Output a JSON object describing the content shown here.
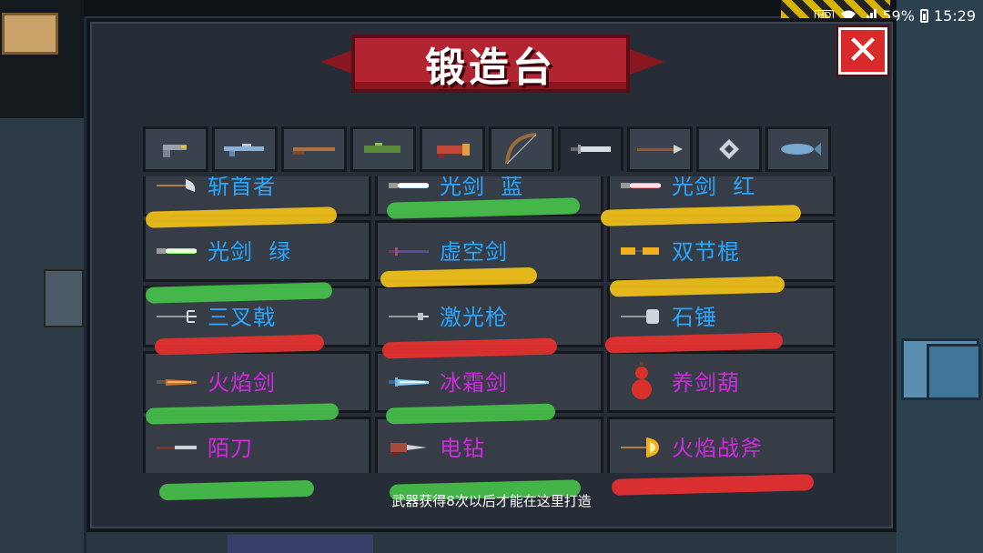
{
  "status_bar": {
    "hd_badge": "HD",
    "battery_percent": "59%",
    "time": "15:29"
  },
  "title": "锻造台",
  "close_icon": "close-icon",
  "tabs": [
    {
      "icon": "pistol-icon",
      "selected": false
    },
    {
      "icon": "rifle-icon",
      "selected": false
    },
    {
      "icon": "shotgun-icon",
      "selected": false
    },
    {
      "icon": "launcher-icon",
      "selected": false
    },
    {
      "icon": "heavy-gun-icon",
      "selected": false
    },
    {
      "icon": "bow-icon",
      "selected": false
    },
    {
      "icon": "sword-icon",
      "selected": true
    },
    {
      "icon": "spear-icon",
      "selected": false
    },
    {
      "icon": "staff-icon",
      "selected": false
    },
    {
      "icon": "fish-icon",
      "selected": false
    }
  ],
  "weapons": [
    {
      "label": "斩首者",
      "color": "blue",
      "icon": "scythe-icon",
      "marker": "yellow"
    },
    {
      "label": "光剑  蓝",
      "color": "blue",
      "icon": "lightsaber-blue-icon",
      "marker": "green"
    },
    {
      "label": "光剑  红",
      "color": "blue",
      "icon": "lightsaber-red-icon",
      "marker": "yellow"
    },
    {
      "label": "光剑  绿",
      "color": "blue",
      "icon": "lightsaber-green-icon",
      "marker": "green"
    },
    {
      "label": "虚空剑",
      "color": "blue",
      "icon": "void-sword-icon",
      "marker": "yellow"
    },
    {
      "label": "双节棍",
      "color": "blue",
      "icon": "nunchaku-icon",
      "marker": "yellow"
    },
    {
      "label": "三叉戟",
      "color": "blue",
      "icon": "trident-icon",
      "marker": "red"
    },
    {
      "label": "激光枪",
      "color": "blue",
      "icon": "laser-spear-icon",
      "marker": "red"
    },
    {
      "label": "石锤",
      "color": "blue",
      "icon": "stone-hammer-icon",
      "marker": "red"
    },
    {
      "label": "火焰剑",
      "color": "purple",
      "icon": "flame-sword-icon",
      "marker": "green"
    },
    {
      "label": "冰霜剑",
      "color": "purple",
      "icon": "frost-sword-icon",
      "marker": "green"
    },
    {
      "label": "养剑葫",
      "color": "purple",
      "icon": "gourd-icon",
      "marker": null
    },
    {
      "label": "陌刀",
      "color": "purple",
      "icon": "modao-blade-icon",
      "marker": "green"
    },
    {
      "label": "电钻",
      "color": "purple",
      "icon": "drill-icon",
      "marker": "green"
    },
    {
      "label": "火焰战斧",
      "color": "purple",
      "icon": "flame-axe-icon",
      "marker": "red"
    }
  ],
  "footer_note": "武器获得8次以后才能在这里打造",
  "colors": {
    "label_blue": "#2aa6ff",
    "label_purple": "#d02adf",
    "marker_yellow": "#f3c11a",
    "marker_green": "#46c04a",
    "marker_red": "#e83030",
    "ribbon_red": "#b22432"
  }
}
